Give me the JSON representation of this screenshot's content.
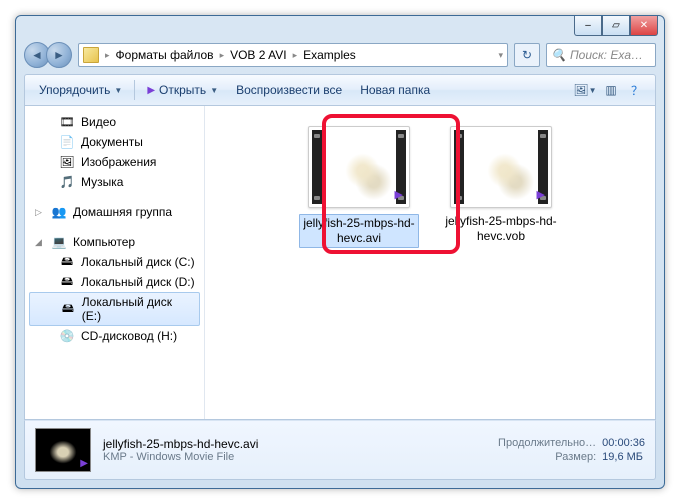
{
  "caption": {
    "minimize": "–",
    "maximize": "▱",
    "close": "✕"
  },
  "nav": {
    "back": "◄",
    "forward": "►"
  },
  "breadcrumbs": [
    "Форматы файлов",
    "VOB 2 AVI",
    "Examples"
  ],
  "search": {
    "placeholder": "Поиск: Exa…"
  },
  "toolbar": {
    "organize": "Упорядочить",
    "open": "Открыть",
    "play_all": "Воспроизвести все",
    "new_folder": "Новая папка"
  },
  "tree": {
    "video": "Видео",
    "documents": "Документы",
    "pictures": "Изображения",
    "music": "Музыка",
    "homegroup": "Домашняя группа",
    "computer": "Компьютер",
    "disk_c": "Локальный диск (C:)",
    "disk_d": "Локальный диск (D:)",
    "disk_e": "Локальный диск (E:)",
    "cd_h": "CD-дисковод (H:)"
  },
  "files": [
    {
      "name": "jellyfish-25-mbps-hd-hevc.avi",
      "selected": true
    },
    {
      "name": "jellyfish-25-mbps-hd-hevc.vob",
      "selected": false
    }
  ],
  "details": {
    "filename": "jellyfish-25-mbps-hd-hevc.avi",
    "filetype": "KMP - Windows Movie File",
    "duration_label": "Продолжительно…",
    "duration_value": "00:00:36",
    "size_label": "Размер:",
    "size_value": "19,6 МБ"
  }
}
